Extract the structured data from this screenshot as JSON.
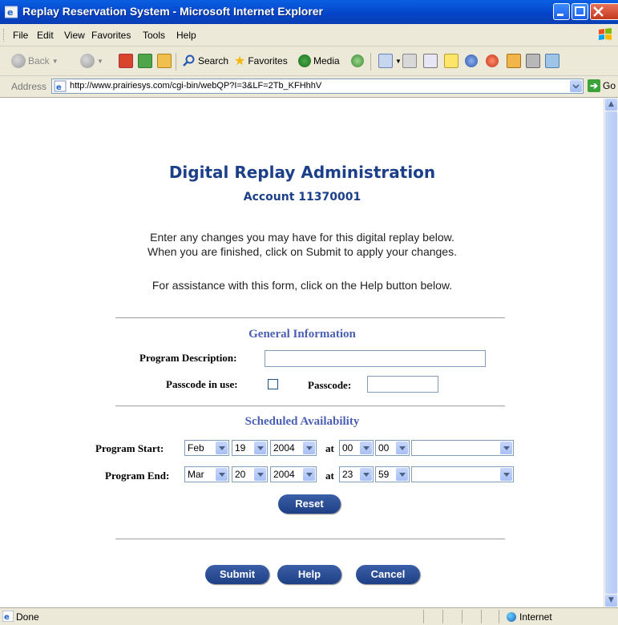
{
  "window": {
    "title": "Replay Reservation System - Microsoft Internet Explorer"
  },
  "menu": [
    "File",
    "Edit",
    "View",
    "Favorites",
    "Tools",
    "Help"
  ],
  "toolbar": {
    "back": "Back",
    "search": "Search",
    "favorites": "Favorites",
    "media": "Media"
  },
  "address": {
    "label": "Address",
    "url": "http://www.prairiesys.com/cgi-bin/webQP?I=3&LF=2Tb_KFHhhV",
    "go": "Go"
  },
  "page": {
    "title": "Digital Replay Administration",
    "account": "Account 11370001",
    "instructions": [
      "Enter any changes you may have for this digital replay below.",
      "When you are finished, click on Submit to apply your changes.",
      "For assistance with this form, click on the Help button below."
    ],
    "general": {
      "heading": "General Information",
      "program_description_label": "Program Description:",
      "program_description_value": "",
      "passcode_in_use_label": "Passcode in use:",
      "passcode_in_use_checked": false,
      "passcode_label": "Passcode:",
      "passcode_value": ""
    },
    "schedule": {
      "heading": "Scheduled Availability",
      "start_label": "Program Start:",
      "start": {
        "month": "Feb",
        "day": "19",
        "year": "2004",
        "at": "at",
        "hour": "00",
        "minute": "00",
        "zone": ""
      },
      "end_label": "Program End:",
      "end": {
        "month": "Mar",
        "day": "20",
        "year": "2004",
        "at": "at",
        "hour": "23",
        "minute": "59",
        "zone": ""
      },
      "reset": "Reset"
    },
    "buttons": {
      "submit": "Submit",
      "help": "Help",
      "cancel": "Cancel"
    }
  },
  "status": {
    "left": "Done",
    "zone": "Internet"
  }
}
